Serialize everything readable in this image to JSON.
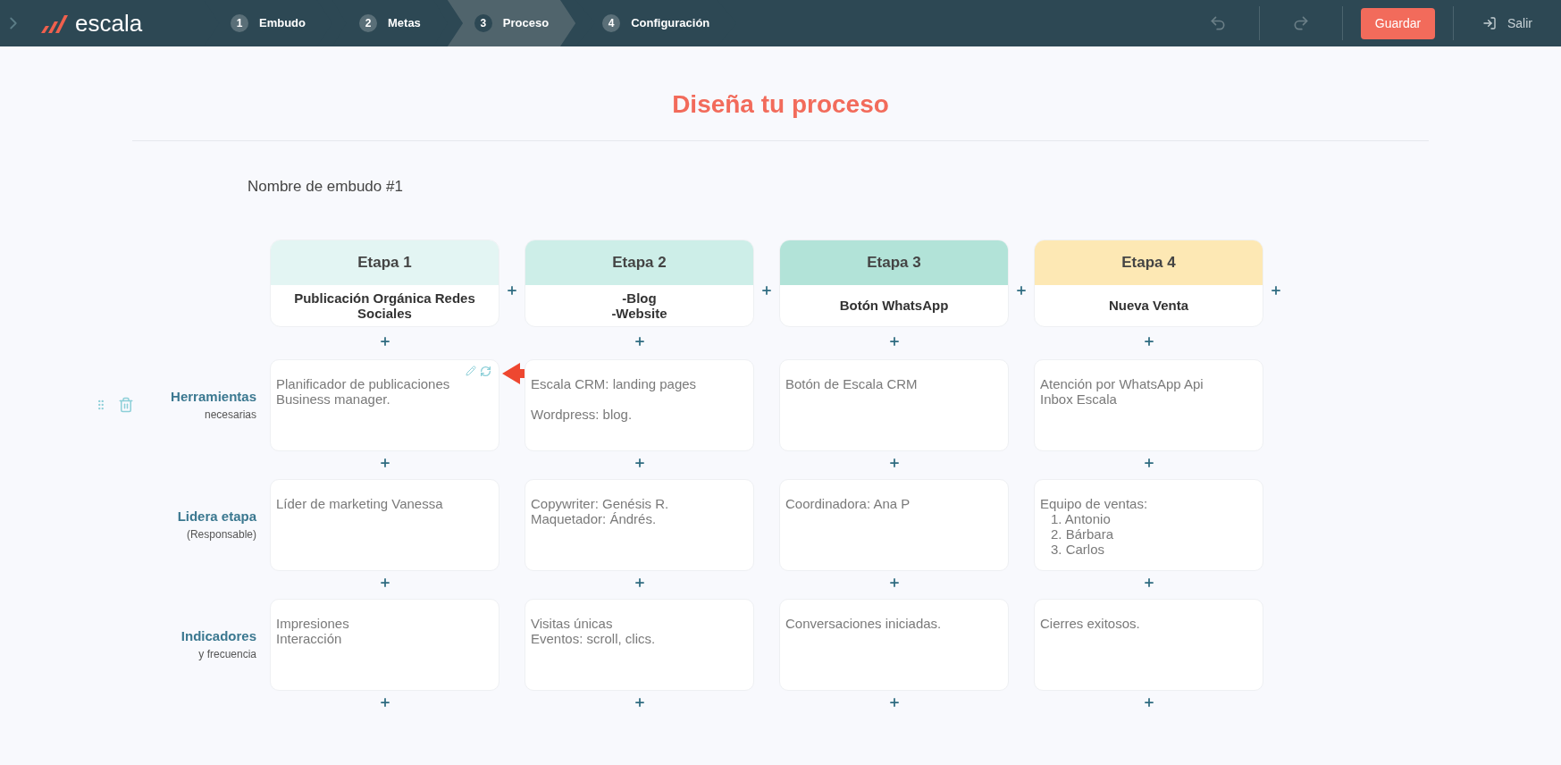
{
  "nav": {
    "brand": "escala",
    "steps": [
      {
        "number": "1",
        "label": "Embudo",
        "selected": false
      },
      {
        "number": "2",
        "label": "Metas",
        "selected": false
      },
      {
        "number": "3",
        "label": "Proceso",
        "selected": true
      },
      {
        "number": "4",
        "label": "Configuración",
        "selected": false
      }
    ],
    "undo": {
      "disabled": true
    },
    "redo": {
      "disabled": true
    },
    "save": "Guardar",
    "exit": "Salir"
  },
  "title": "Diseña tu proceso",
  "funnel_name": "Nombre de embudo #1",
  "stages": [
    {
      "label": "Etapa 1",
      "name": "Publicación Orgánica Redes Sociales",
      "color": "#e3f5f3"
    },
    {
      "label": "Etapa 2",
      "name": "-Blog\n-Website",
      "color": "#cdeee8"
    },
    {
      "label": "Etapa 3",
      "name": "Botón WhatsApp",
      "color": "#b2e3d8"
    },
    {
      "label": "Etapa 4",
      "name": "Nueva Venta",
      "color": "#fde8b4"
    }
  ],
  "rows": [
    {
      "label": "Herramientas",
      "sublabel": "necesarias",
      "tools": true,
      "cells": [
        {
          "text": "Planificador de publicaciones\nBusiness manager.",
          "editing": true
        },
        {
          "text": "Escala CRM: landing pages\n\nWordpress: blog.",
          "editing": false
        },
        {
          "text": "Botón de Escala CRM",
          "editing": false
        },
        {
          "text": "Atención por WhatsApp Api\nInbox Escala",
          "editing": false
        }
      ]
    },
    {
      "label": "Lidera etapa",
      "sublabel": "(Responsable)",
      "tools": false,
      "cells": [
        {
          "text": "Líder de marketing Vanessa",
          "editing": false
        },
        {
          "text": "Copywriter: Genésis R.\nMaquetador: Ándrés.",
          "editing": false
        },
        {
          "text": "Coordinadora: Ana P",
          "editing": false
        },
        {
          "text": "Equipo de ventas:",
          "list": [
            "1. Antonio",
            "2. Bárbara",
            "3. Carlos"
          ],
          "editing": false
        }
      ]
    },
    {
      "label": "Indicadores",
      "sublabel": "y frecuencia",
      "tools": false,
      "cells": [
        {
          "text": "Impresiones\nInteracción",
          "editing": false
        },
        {
          "text": "Visitas únicas\nEventos: scroll, clics.",
          "editing": false
        },
        {
          "text": "Conversaciones iniciadas.",
          "editing": false
        },
        {
          "text": "Cierres exitosos.",
          "editing": false
        }
      ]
    }
  ]
}
